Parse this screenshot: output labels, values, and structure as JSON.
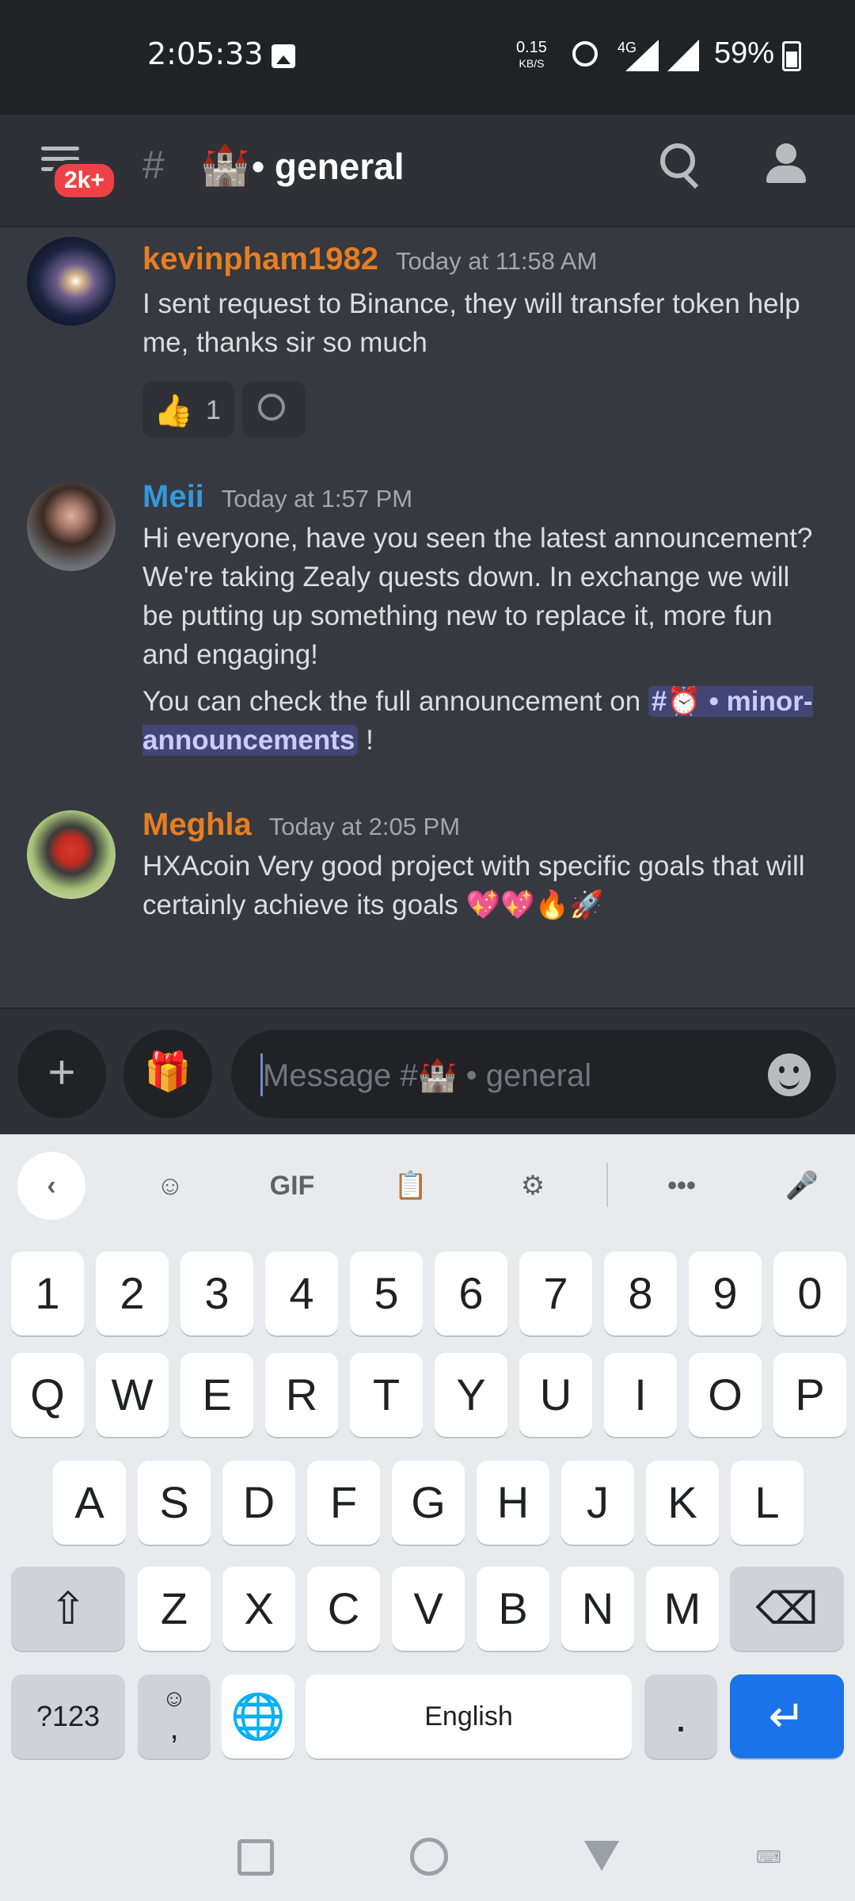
{
  "status_bar": {
    "time": "2:05:33",
    "net_speed": "0.15",
    "net_speed_unit": "KB/S",
    "network_type": "4G",
    "battery": "59%"
  },
  "header": {
    "badge": "2k+",
    "channel_emoji": "🏰",
    "channel_name": "• general"
  },
  "messages": [
    {
      "username": "kevinpham1982",
      "username_color": "#e67e22",
      "timestamp": "Today at 11:58 AM",
      "text": "I sent request to Binance, they will transfer token help me, thanks sir so much",
      "reaction": {
        "emoji": "👍",
        "count": "1"
      }
    },
    {
      "username": "Meii",
      "username_color": "#3498db",
      "timestamp": "Today at 1:57 PM",
      "text": "Hi everyone, have you seen the latest announcement? We're taking Zealy quests down. In exchange we will be putting up something new to replace it, more fun and engaging!",
      "text2_prefix": "You can check the full announcement on ",
      "mention": "#⏰ • minor-announcements",
      "text2_suffix": " !"
    },
    {
      "username": "Meghla",
      "username_color": "#e67e22",
      "timestamp": "Today at 2:05 PM",
      "text": "HXAcoin Very good project with specific goals that will certainly achieve its goals",
      "emojis": "💖💖🔥🚀"
    }
  ],
  "composer": {
    "placeholder": "Message #🏰 • general"
  },
  "keyboard": {
    "toolbar": [
      "back",
      "sticker",
      "GIF",
      "clipboard",
      "settings",
      "more",
      "mic"
    ],
    "gif_label": "GIF",
    "more_label": "•••",
    "row_numbers": [
      "1",
      "2",
      "3",
      "4",
      "5",
      "6",
      "7",
      "8",
      "9",
      "0"
    ],
    "row1": [
      "Q",
      "W",
      "E",
      "R",
      "T",
      "Y",
      "U",
      "I",
      "O",
      "P"
    ],
    "row2": [
      "A",
      "S",
      "D",
      "F",
      "G",
      "H",
      "J",
      "K",
      "L"
    ],
    "row3": [
      "Z",
      "X",
      "C",
      "V",
      "B",
      "N",
      "M"
    ],
    "sym_label": "?123",
    "comma": ",",
    "space_label": "English",
    "period": "."
  }
}
